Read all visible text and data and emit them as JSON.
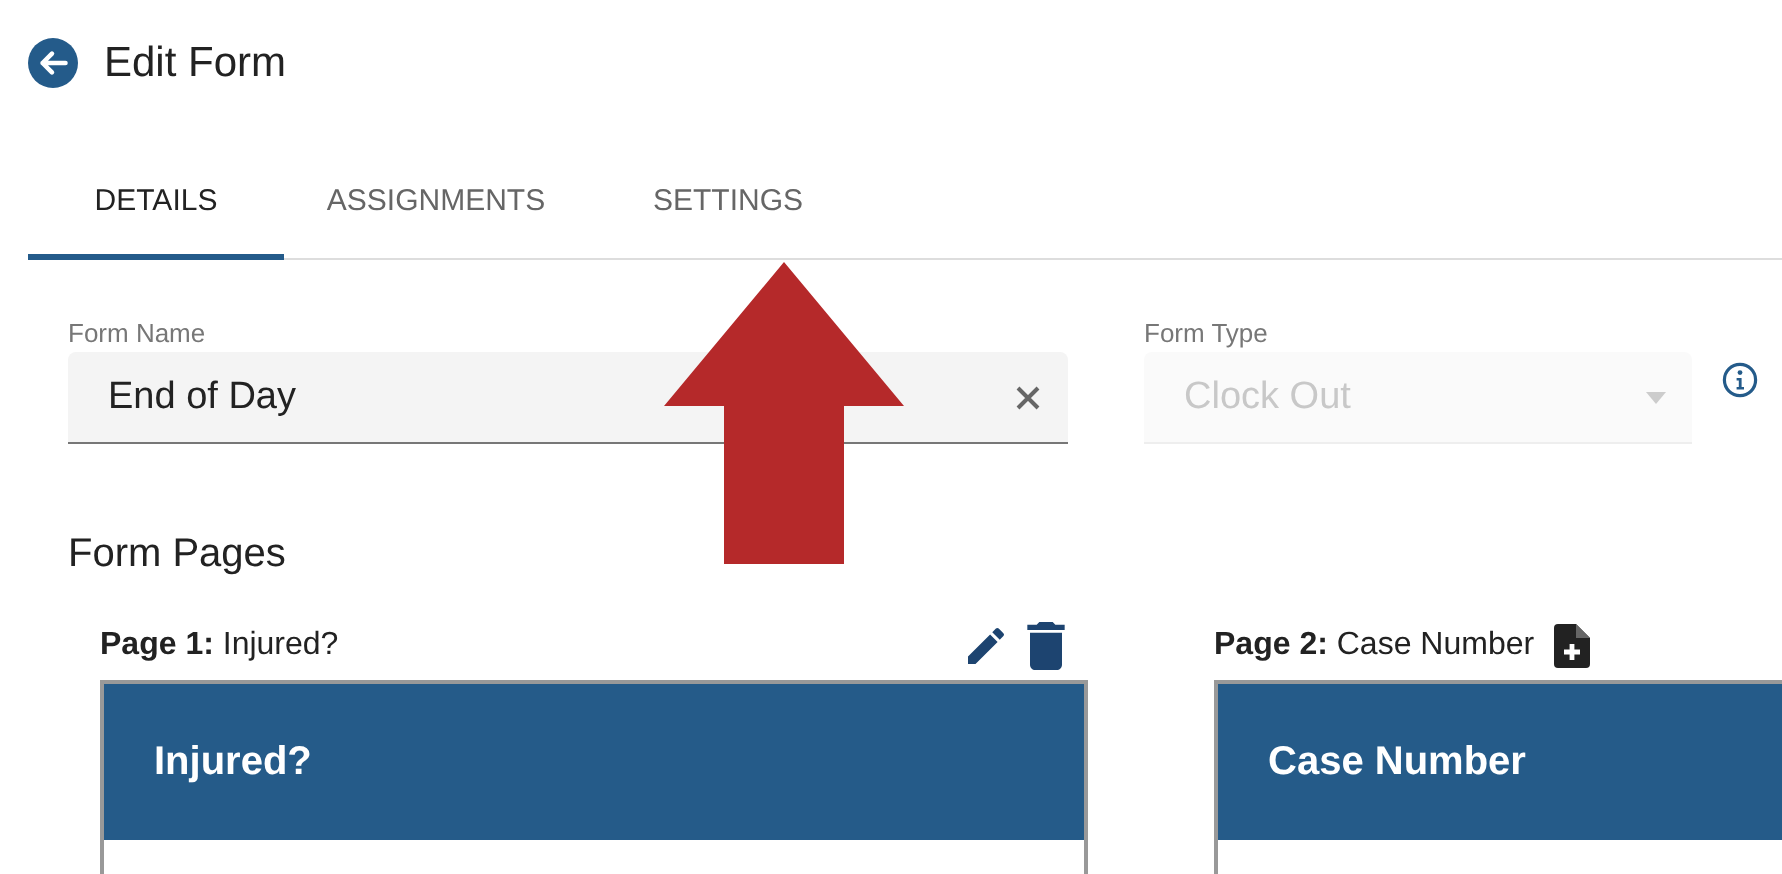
{
  "header": {
    "title": "Edit Form"
  },
  "tabs": [
    {
      "label": "DETAILS",
      "selected": true
    },
    {
      "label": "ASSIGNMENTS",
      "selected": false
    },
    {
      "label": "SETTINGS",
      "selected": false
    }
  ],
  "fields": [
    {
      "label": "Form Name",
      "value": "End of Day",
      "disabled": false
    },
    {
      "label": "Form Type",
      "value": "Clock Out",
      "disabled": true
    }
  ],
  "section_title": "Form Pages",
  "pages": [
    {
      "prefix": "Page 1:",
      "name": "Injured?",
      "heading": "Injured?",
      "kind": "editable"
    },
    {
      "prefix": "Page 2:",
      "name": "Case Number",
      "heading": "Case Number",
      "kind": "new"
    }
  ]
}
